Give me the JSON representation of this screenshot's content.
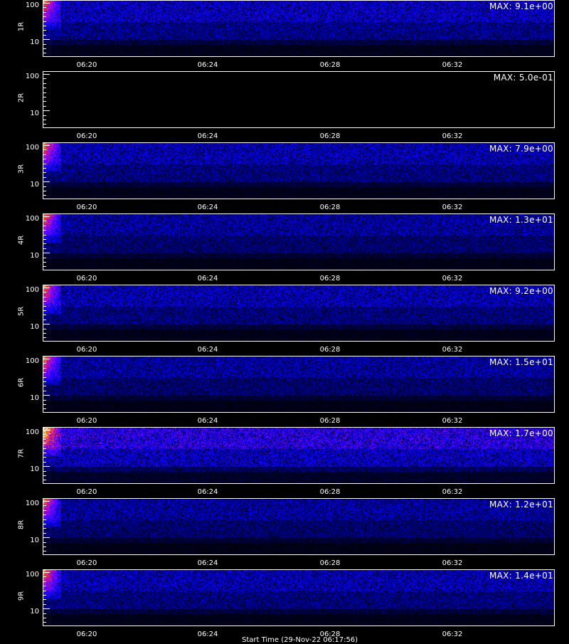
{
  "chart_data": [
    {
      "type": "heatmap",
      "ylabel": "1R",
      "yticks": [
        "100",
        "10"
      ],
      "xticks": [
        "06:20",
        "06:24",
        "06:28",
        "06:32"
      ],
      "max_label": "MAX: 9.1e+00",
      "intensity": 0.55,
      "noise_floor": 0.35
    },
    {
      "type": "heatmap",
      "ylabel": "2R",
      "yticks": [
        "100",
        "10"
      ],
      "xticks": [
        "06:20",
        "06:24",
        "06:28",
        "06:32"
      ],
      "max_label": "MAX: 5.0e-01",
      "intensity": 0.0,
      "noise_floor": 0.0
    },
    {
      "type": "heatmap",
      "ylabel": "3R",
      "yticks": [
        "100",
        "10"
      ],
      "xticks": [
        "06:20",
        "06:24",
        "06:28",
        "06:32"
      ],
      "max_label": "MAX: 7.9e+00",
      "intensity": 0.6,
      "noise_floor": 0.3
    },
    {
      "type": "heatmap",
      "ylabel": "4R",
      "yticks": [
        "100",
        "10"
      ],
      "xticks": [
        "06:20",
        "06:24",
        "06:28",
        "06:32"
      ],
      "max_label": "MAX: 1.3e+01",
      "intensity": 0.6,
      "noise_floor": 0.25
    },
    {
      "type": "heatmap",
      "ylabel": "5R",
      "yticks": [
        "100",
        "10"
      ],
      "xticks": [
        "06:20",
        "06:24",
        "06:28",
        "06:32"
      ],
      "max_label": "MAX: 9.2e+00",
      "intensity": 0.6,
      "noise_floor": 0.3
    },
    {
      "type": "heatmap",
      "ylabel": "6R",
      "yticks": [
        "100",
        "10"
      ],
      "xticks": [
        "06:20",
        "06:24",
        "06:28",
        "06:32"
      ],
      "max_label": "MAX: 1.5e+01",
      "intensity": 0.6,
      "noise_floor": 0.25
    },
    {
      "type": "heatmap",
      "ylabel": "7R",
      "yticks": [
        "100",
        "10"
      ],
      "xticks": [
        "06:20",
        "06:24",
        "06:28",
        "06:32"
      ],
      "max_label": "MAX: 1.7e+00",
      "intensity": 0.7,
      "noise_floor": 0.5
    },
    {
      "type": "heatmap",
      "ylabel": "8R",
      "yticks": [
        "100",
        "10"
      ],
      "xticks": [
        "06:20",
        "06:24",
        "06:28",
        "06:32"
      ],
      "max_label": "MAX: 1.2e+01",
      "intensity": 0.6,
      "noise_floor": 0.25
    },
    {
      "type": "heatmap",
      "ylabel": "9R",
      "yticks": [
        "100",
        "10"
      ],
      "xticks": [
        "06:20",
        "06:24",
        "06:28",
        "06:32"
      ],
      "max_label": "MAX: 1.4e+01",
      "intensity": 0.6,
      "noise_floor": 0.3
    }
  ],
  "footer": "Start Time (29-Nov-22 06:17:56)"
}
